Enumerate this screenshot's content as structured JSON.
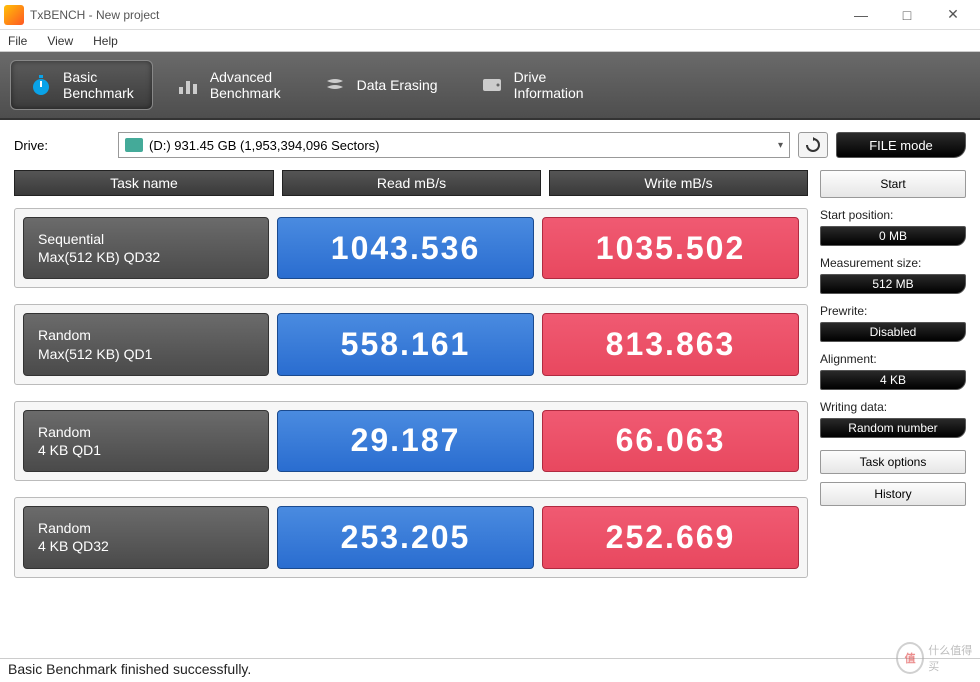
{
  "window": {
    "title": "TxBENCH - New project",
    "min": "—",
    "max": "□",
    "close": "✕"
  },
  "menu": {
    "file": "File",
    "view": "View",
    "help": "Help"
  },
  "tabs": {
    "basic": "Basic\nBenchmark",
    "advanced": "Advanced\nBenchmark",
    "erase": "Data Erasing",
    "drive": "Drive\nInformation"
  },
  "drive": {
    "label": "Drive:",
    "value": "(D:)   931.45 GB (1,953,394,096 Sectors)",
    "filemode": "FILE mode"
  },
  "headers": {
    "task": "Task name",
    "read": "Read mB/s",
    "write": "Write mB/s"
  },
  "rows": [
    {
      "name1": "Sequential",
      "name2": "Max(512 KB) QD32",
      "read": "1043.536",
      "write": "1035.502"
    },
    {
      "name1": "Random",
      "name2": "Max(512 KB) QD1",
      "read": "558.161",
      "write": "813.863"
    },
    {
      "name1": "Random",
      "name2": "4 KB QD1",
      "read": "29.187",
      "write": "66.063"
    },
    {
      "name1": "Random",
      "name2": "4 KB QD32",
      "read": "253.205",
      "write": "252.669"
    }
  ],
  "sidebar": {
    "start": "Start",
    "startpos_l": "Start position:",
    "startpos_v": "0 MB",
    "msize_l": "Measurement size:",
    "msize_v": "512 MB",
    "prewrite_l": "Prewrite:",
    "prewrite_v": "Disabled",
    "align_l": "Alignment:",
    "align_v": "4 KB",
    "wdata_l": "Writing data:",
    "wdata_v": "Random number",
    "taskopt": "Task options",
    "history": "History"
  },
  "status": "Basic Benchmark finished successfully.",
  "watermark": "什么值得买",
  "chart_data": {
    "type": "table",
    "title": "TxBENCH Basic Benchmark Results",
    "columns": [
      "Task name",
      "Read mB/s",
      "Write mB/s"
    ],
    "rows": [
      [
        "Sequential Max(512 KB) QD32",
        1043.536,
        1035.502
      ],
      [
        "Random Max(512 KB) QD1",
        558.161,
        813.863
      ],
      [
        "Random 4 KB QD1",
        29.187,
        66.063
      ],
      [
        "Random 4 KB QD32",
        253.205,
        252.669
      ]
    ],
    "drive": "(D:) 931.45 GB (1,953,394,096 Sectors)",
    "settings": {
      "start_position": "0 MB",
      "measurement_size": "512 MB",
      "prewrite": "Disabled",
      "alignment": "4 KB",
      "writing_data": "Random number"
    }
  }
}
